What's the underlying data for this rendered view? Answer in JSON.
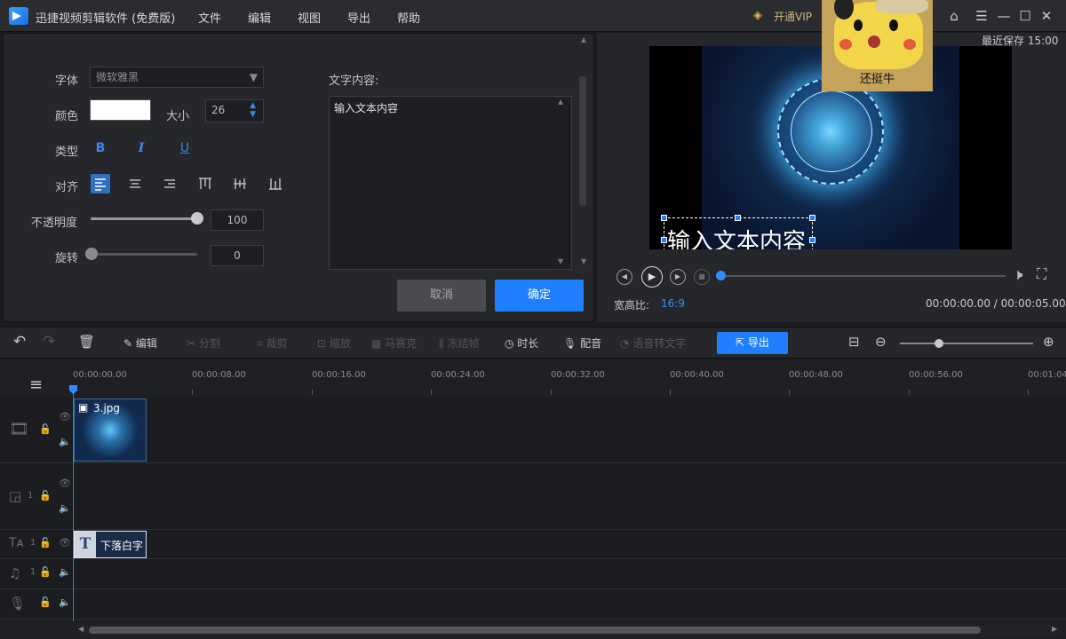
{
  "app": {
    "title": "迅捷视频剪辑软件 (免费版)"
  },
  "menu": [
    "文件",
    "编辑",
    "视图",
    "导出",
    "帮助"
  ],
  "vip_label": "开通VIP",
  "sticker_caption": "还挺牛",
  "last_saved": "最近保存 15:00",
  "text_panel": {
    "font_label": "字体",
    "font_value": "微软雅黑",
    "color_label": "颜色",
    "color_value": "#ffffff",
    "size_label": "大小",
    "size_value": "26",
    "style_label": "类型",
    "bold": "B",
    "italic": "I",
    "underline": "U",
    "align_label": "对齐",
    "opacity_label": "不透明度",
    "opacity_value": "100",
    "rotate_label": "旋转",
    "rotate_value": "0",
    "content_label": "文字内容:",
    "content_value": "输入文本内容",
    "cancel": "取消",
    "confirm": "确定"
  },
  "preview": {
    "overlay_text": "输入文本内容",
    "aspect_label": "宽高比:",
    "aspect_value": "16:9",
    "time": "00:00:00.00 / 00:00:05.00",
    "progress": 0
  },
  "toolbar": {
    "edit": "编辑",
    "split": "分割",
    "crop": "裁剪",
    "zoom": "缩放",
    "mosaic": "马赛克",
    "freeze": "冻结帧",
    "duration": "时长",
    "dub": "配音",
    "speech": "语音转文字",
    "export": "导出"
  },
  "timeline": {
    "ticks": [
      "00:00:00.00",
      "00:00:08.00",
      "00:00:16.00",
      "00:00:24.00",
      "00:00:32.00",
      "00:00:40.00",
      "00:00:48.00",
      "00:00:56.00",
      "00:01:04"
    ],
    "video_clip": "3.jpg",
    "text_clip": "下落白字",
    "track_pip_index": "1",
    "track_text_index": "1",
    "track_music_index": "1"
  }
}
